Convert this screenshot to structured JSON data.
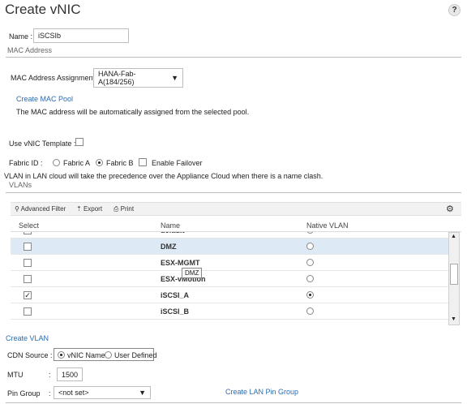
{
  "header": {
    "title": "Create vNIC",
    "help": "?"
  },
  "name_field": {
    "label": "Name :",
    "value": "iSCSIb"
  },
  "mac": {
    "section_title": "MAC Address",
    "assignment_label": "MAC Address Assignment:",
    "assignment_value": "HANA-Fab-A(184/256)",
    "create_pool_link": "Create MAC Pool",
    "info_text": "The MAC address will be automatically assigned from the selected pool."
  },
  "template": {
    "label": "Use vNIC Template :",
    "checked": false
  },
  "fabric": {
    "label": "Fabric ID :",
    "option_a": "Fabric A",
    "option_b": "Fabric B",
    "selected": "Fabric B",
    "failover_label": "Enable Failover"
  },
  "notice": "VLAN in LAN cloud will take the precedence over the Appliance Cloud when there is a name clash.",
  "vlans": {
    "section_title": "VLANs",
    "toolbar": {
      "filter": "Advanced Filter",
      "export": "Export",
      "print": "Print"
    },
    "columns": {
      "select": "Select",
      "name": "Name",
      "native": "Native VLAN"
    },
    "rows": [
      {
        "name": "default",
        "checked": false,
        "native": false
      },
      {
        "name": "DMZ",
        "checked": false,
        "native": false
      },
      {
        "name": "ESX-MGMT",
        "checked": false,
        "native": false
      },
      {
        "name": "ESX-vMotion",
        "checked": false,
        "native": false
      },
      {
        "name": "iSCSI_A",
        "checked": true,
        "native": true
      },
      {
        "name": "iSCSI_B",
        "checked": false,
        "native": false
      }
    ],
    "tooltip": "DMZ",
    "create_link": "Create VLAN"
  },
  "cdn": {
    "label": "CDN Source :",
    "option_vnic": "vNIC Name",
    "option_user": "User Defined",
    "selected": "vNIC Name"
  },
  "mtu": {
    "label": "MTU",
    "colon": ":",
    "value": "1500"
  },
  "pin_group": {
    "label": "Pin Group",
    "colon": ":",
    "value": "<not set>",
    "create_link": "Create LAN Pin Group"
  }
}
